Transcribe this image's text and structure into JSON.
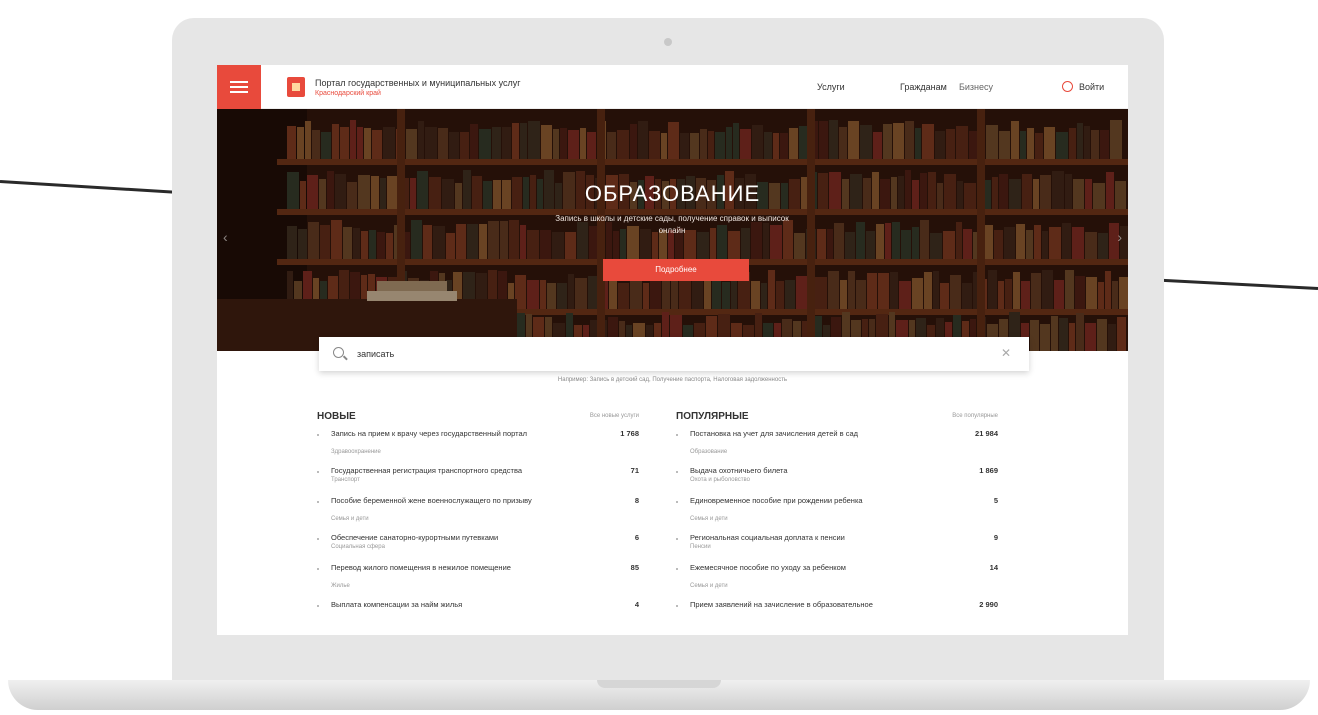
{
  "header": {
    "site_title": "Портал государственных и муниципальных услуг",
    "site_subtitle": "Краснодарский край",
    "nav_a": "Услуги",
    "nav_b": "Гражданам",
    "nav_c": "Бизнесу",
    "login": "Войти"
  },
  "hero": {
    "title": "ОБРАЗОВАНИЕ",
    "description": "Запись в школы и детские сады, получение справок и выписок онлайн",
    "button": "Подробнее"
  },
  "search": {
    "value": "записать",
    "hints": "Например: Запись в детский сад, Получение паспорта, Налоговая задолженность"
  },
  "lists": {
    "new": {
      "title": "НОВЫЕ",
      "all_link": "Все новые услуги",
      "items": [
        {
          "title": "Запись на прием к врачу через государственный портал",
          "sub": "Здравоохранение",
          "count": "1 768"
        },
        {
          "title": "Государственная регистрация транспортного средства",
          "sub": "Транспорт",
          "count": "71"
        },
        {
          "title": "Пособие беременной жене военнослужащего по призыву",
          "sub": "Семья и дети",
          "count": "8"
        },
        {
          "title": "Обеспечение санаторно-курортными путевками",
          "sub": "Социальная сфера",
          "count": "6"
        },
        {
          "title": "Перевод жилого помещения в нежилое помещение",
          "sub": "Жилье",
          "count": "85"
        },
        {
          "title": "Выплата компенсации за найм жилья",
          "sub": "",
          "count": "4"
        }
      ]
    },
    "popular": {
      "title": "ПОПУЛЯРНЫЕ",
      "all_link": "Все популярные",
      "items": [
        {
          "title": "Постановка на учет для зачисления детей в сад",
          "sub": "Образование",
          "count": "21 984"
        },
        {
          "title": "Выдача охотничьего билета",
          "sub": "Охота и рыболовство",
          "count": "1 869"
        },
        {
          "title": "Единовременное пособие при рождении ребенка",
          "sub": "Семья и дети",
          "count": "5"
        },
        {
          "title": "Региональная социальная доплата к пенсии",
          "sub": "Пенсии",
          "count": "9"
        },
        {
          "title": "Ежемесячное пособие по уходу за ребенком",
          "sub": "Семья и дети",
          "count": "14"
        },
        {
          "title": "Прием заявлений на зачисление в образовательное",
          "sub": "",
          "count": "2 990"
        }
      ]
    }
  },
  "colors": {
    "accent": "#e84a3c"
  }
}
